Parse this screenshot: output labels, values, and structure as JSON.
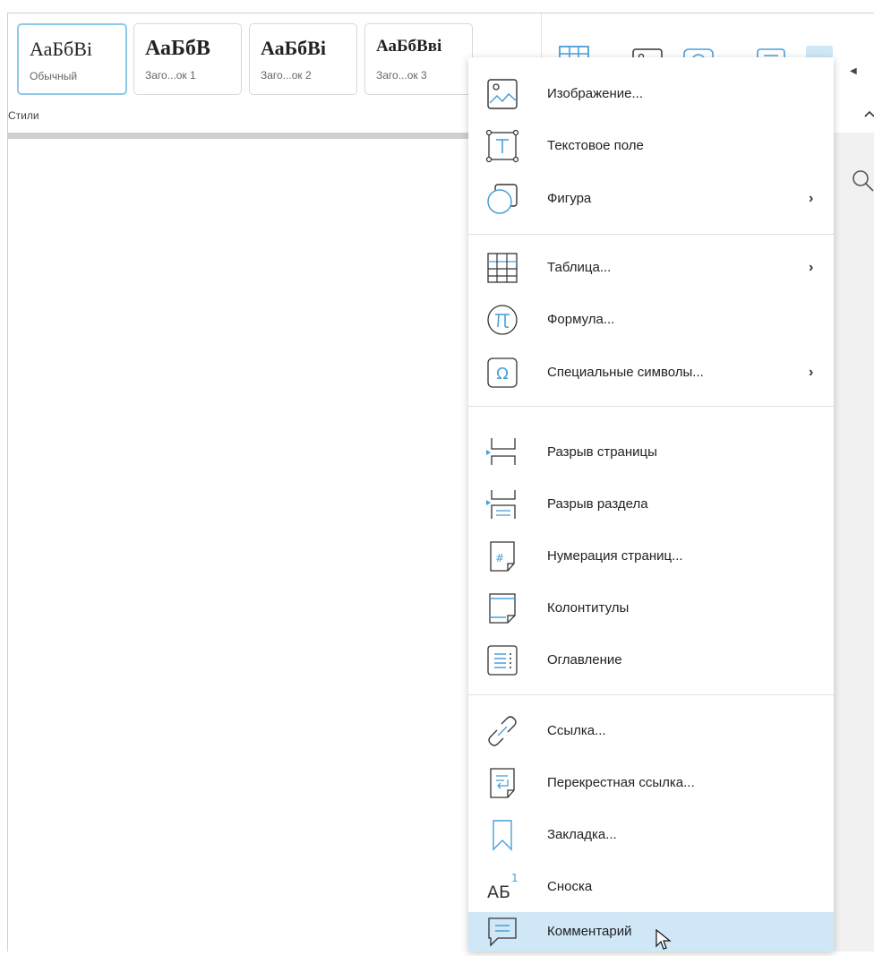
{
  "styles_panel": {
    "label": "Стили",
    "cards": [
      {
        "sample": "АаБбВі",
        "caption": "Обычный"
      },
      {
        "sample": "АаБбВ",
        "caption": "Заго...ок 1"
      },
      {
        "sample": "АаБбВі",
        "caption": "Заго...ок 2"
      },
      {
        "sample": "АаБбВві",
        "caption": "Заго...ок 3"
      }
    ]
  },
  "insert_menu": {
    "items": [
      {
        "label": "Изображение...",
        "icon": "image-icon"
      },
      {
        "label": "Текстовое поле",
        "icon": "text-box-icon"
      },
      {
        "label": "Фигура",
        "icon": "shape-icon",
        "submenu": "›"
      },
      {
        "label": "Таблица...",
        "icon": "table-icon",
        "submenu": "›"
      },
      {
        "label": "Формула...",
        "icon": "formula-icon"
      },
      {
        "label": "Специальные символы...",
        "icon": "special-symbols-icon",
        "submenu": "›"
      },
      {
        "label": "Разрыв страницы",
        "icon": "page-break-icon"
      },
      {
        "label": "Разрыв раздела",
        "icon": "section-break-icon"
      },
      {
        "label": "Нумерация страниц...",
        "icon": "page-numbering-icon"
      },
      {
        "label": "Колонтитулы",
        "icon": "header-footer-icon"
      },
      {
        "label": "Оглавление",
        "icon": "table-of-contents-icon"
      },
      {
        "label": "Ссылка...",
        "icon": "link-icon"
      },
      {
        "label": "Перекрестная ссылка...",
        "icon": "cross-reference-icon"
      },
      {
        "label": "Закладка...",
        "icon": "bookmark-icon"
      },
      {
        "label": "Сноска",
        "icon": "footnote-icon",
        "icon_text": "АБ",
        "icon_sup": "1"
      },
      {
        "label": "Комментарий",
        "icon": "comment-icon",
        "highlighted": true
      }
    ]
  },
  "colors": {
    "accent": "#4a9fd8",
    "highlight": "#cfe7f7",
    "icon_stroke": "#2b2b2b"
  }
}
